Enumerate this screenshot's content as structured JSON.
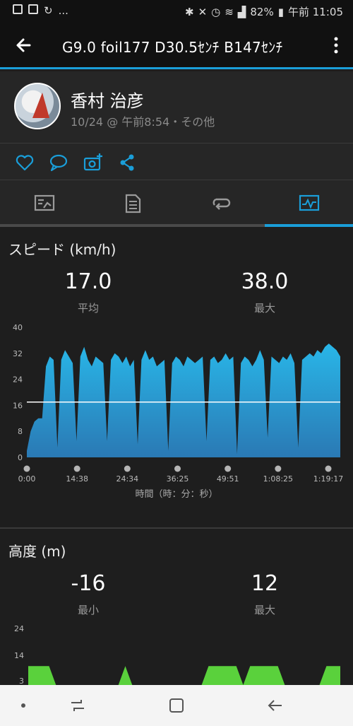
{
  "status_bar": {
    "left_icons": [
      "image-icon",
      "bus-icon",
      "sync-icon"
    ],
    "ellipsis": "...",
    "battery": "82%",
    "time": "午前 11:05"
  },
  "app_bar": {
    "title": "G9.0  foil177  D30.5ｾﾝﾁ  B147ｾﾝﾁ"
  },
  "profile": {
    "name": "香村 治彦",
    "meta": "10/24 @ 午前8:54・その他"
  },
  "actions": [
    "like-icon",
    "comment-icon",
    "add-photo-icon",
    "share-icon"
  ],
  "tabs": [
    "summary-tab",
    "details-tab",
    "laps-tab",
    "charts-tab"
  ],
  "speed": {
    "title": "スピード (km/h)",
    "avg_value": "17.0",
    "avg_label": "平均",
    "max_value": "38.0",
    "max_label": "最大",
    "x_axis_label": "時間（時：分：秒）"
  },
  "altitude": {
    "title": "高度 (m)",
    "min_value": "-16",
    "min_label": "最小",
    "max_value": "12",
    "max_label": "最大"
  },
  "colors": {
    "accent": "#1a9ed9",
    "speed_fill_top": "#29b6e8",
    "speed_fill_bottom": "#2a79b4",
    "altitude_fill": "#5ad13c",
    "avg_line": "#ffffff"
  },
  "chart_data": [
    {
      "type": "area",
      "title": "スピード (km/h)",
      "xlabel": "時間（時：分：秒）",
      "ylabel": "",
      "ylim": [
        0,
        40
      ],
      "y_ticks": [
        "0",
        "8",
        "16",
        "24",
        "32",
        "40"
      ],
      "x_ticks": [
        "0:00",
        "14:38",
        "24:34",
        "36:25",
        "49:51",
        "1:08:25",
        "1:19:17"
      ],
      "average_line": 17.0,
      "series": [
        {
          "values": [
            2,
            8,
            11,
            12,
            12,
            28,
            31,
            30,
            3,
            30,
            33,
            31,
            29,
            5,
            31,
            34,
            30,
            28,
            31,
            30,
            29,
            5,
            30,
            32,
            31,
            29,
            31,
            28,
            30,
            4,
            30,
            33,
            30,
            31,
            28,
            29,
            30,
            2,
            29,
            31,
            30,
            28,
            31,
            30,
            29,
            30,
            31,
            5,
            30,
            31,
            29,
            30,
            32,
            30,
            31,
            1,
            29,
            31,
            30,
            28,
            30,
            33,
            30,
            6,
            31,
            30,
            29,
            31,
            30,
            32,
            29,
            3,
            30,
            31,
            32,
            31,
            33,
            32,
            34,
            35,
            34,
            33,
            31
          ]
        }
      ]
    },
    {
      "type": "area",
      "title": "高度 (m)",
      "ylim": [
        3,
        24
      ],
      "y_ticks": [
        "3",
        "14",
        "24"
      ],
      "series": [
        {
          "values": [
            10,
            10,
            10,
            10,
            3,
            3,
            3,
            3,
            3,
            3,
            3,
            3,
            3,
            3,
            10,
            3,
            3,
            3,
            3,
            3,
            3,
            3,
            3,
            3,
            3,
            3,
            10,
            10,
            10,
            10,
            10,
            3,
            10,
            10,
            10,
            10,
            10,
            3,
            3,
            3,
            3,
            3,
            3,
            10,
            10,
            10
          ]
        }
      ]
    }
  ]
}
